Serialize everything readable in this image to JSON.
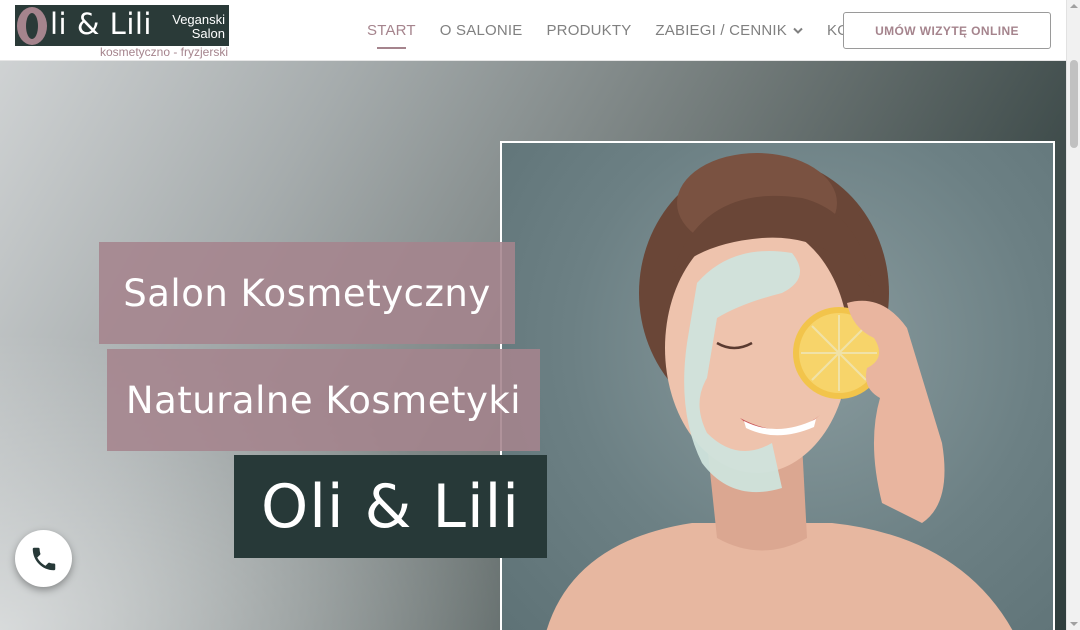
{
  "logo": {
    "name": "li & Lili",
    "tagline_1": "Veganski",
    "tagline_2": "Salon",
    "subtitle": "kosmetyczno - fryzjerski"
  },
  "nav": {
    "items": [
      {
        "label": "START",
        "active": true
      },
      {
        "label": "O SALONIE",
        "active": false
      },
      {
        "label": "PRODUKTY",
        "active": false
      },
      {
        "label": "ZABIEGI / CENNIK",
        "active": false,
        "dropdown": true
      },
      {
        "label": "KONTAKT",
        "active": false
      }
    ],
    "cta": "UMÓW WIZYTĘ ONLINE"
  },
  "hero": {
    "line1": "Salon Kosmetyczny",
    "line2": "Naturalne Kosmetyki",
    "line3": "Oli & Lili",
    "image_icon": "woman-face-mask-lemon-photo"
  },
  "phone_button": {
    "icon": "phone-icon"
  },
  "colors": {
    "brand_mauve": "#a5848d",
    "brand_dark": "#273938",
    "nav_text": "#808080"
  }
}
